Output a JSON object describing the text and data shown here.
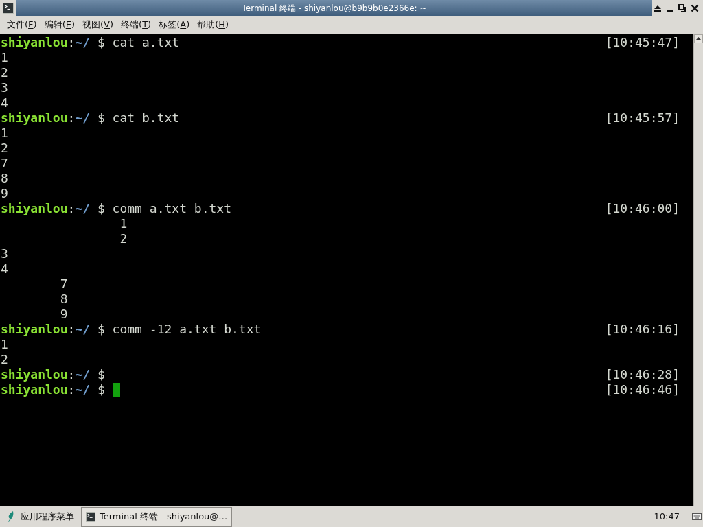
{
  "window": {
    "title": "Terminal 终端 - shiyanlou@b9b9b0e2366e: ~"
  },
  "menu": [
    {
      "before": "文件(",
      "mnemonic": "F",
      "after": ")"
    },
    {
      "before": "编辑(",
      "mnemonic": "E",
      "after": ")"
    },
    {
      "before": "视图(",
      "mnemonic": "V",
      "after": ")"
    },
    {
      "before": "终端(",
      "mnemonic": "T",
      "after": ")"
    },
    {
      "before": "标签(",
      "mnemonic": "A",
      "after": ")"
    },
    {
      "before": "帮助(",
      "mnemonic": "H",
      "after": ")"
    }
  ],
  "terminal": {
    "lines": [
      {
        "kind": "prompt",
        "user": "shiyanlou",
        "separator": ":",
        "path": "~/",
        "symbol": "$",
        "command": "cat a.txt",
        "time": "[10:45:47]",
        "cursor": false
      },
      {
        "kind": "output",
        "text": "1"
      },
      {
        "kind": "output",
        "text": "2"
      },
      {
        "kind": "output",
        "text": "3"
      },
      {
        "kind": "output",
        "text": "4"
      },
      {
        "kind": "prompt",
        "user": "shiyanlou",
        "separator": ":",
        "path": "~/",
        "symbol": "$",
        "command": "cat b.txt",
        "time": "[10:45:57]",
        "cursor": false
      },
      {
        "kind": "output",
        "text": "1"
      },
      {
        "kind": "output",
        "text": "2"
      },
      {
        "kind": "output",
        "text": "7"
      },
      {
        "kind": "output",
        "text": "8"
      },
      {
        "kind": "output",
        "text": "9"
      },
      {
        "kind": "prompt",
        "user": "shiyanlou",
        "separator": ":",
        "path": "~/",
        "symbol": "$",
        "command": "comm a.txt b.txt",
        "time": "[10:46:00]",
        "cursor": false
      },
      {
        "kind": "output",
        "text": "\t\t1"
      },
      {
        "kind": "output",
        "text": "\t\t2"
      },
      {
        "kind": "output",
        "text": "3"
      },
      {
        "kind": "output",
        "text": "4"
      },
      {
        "kind": "output",
        "text": "\t7"
      },
      {
        "kind": "output",
        "text": "\t8"
      },
      {
        "kind": "output",
        "text": "\t9"
      },
      {
        "kind": "prompt",
        "user": "shiyanlou",
        "separator": ":",
        "path": "~/",
        "symbol": "$",
        "command": "comm -12 a.txt b.txt",
        "time": "[10:46:16]",
        "cursor": false
      },
      {
        "kind": "output",
        "text": "1"
      },
      {
        "kind": "output",
        "text": "2"
      },
      {
        "kind": "prompt",
        "user": "shiyanlou",
        "separator": ":",
        "path": "~/",
        "symbol": "$",
        "time": "[10:46:28]",
        "cursor": false
      },
      {
        "kind": "prompt",
        "user": "shiyanlou",
        "separator": ":",
        "path": "~/",
        "symbol": "$",
        "time": "[10:46:46]",
        "cursor": true
      }
    ]
  },
  "taskbar": {
    "app_menu": "应用程序菜单",
    "tasks": [
      {
        "label": "Terminal 终端 - shiyanlou@…"
      }
    ],
    "clock": "10:47"
  }
}
